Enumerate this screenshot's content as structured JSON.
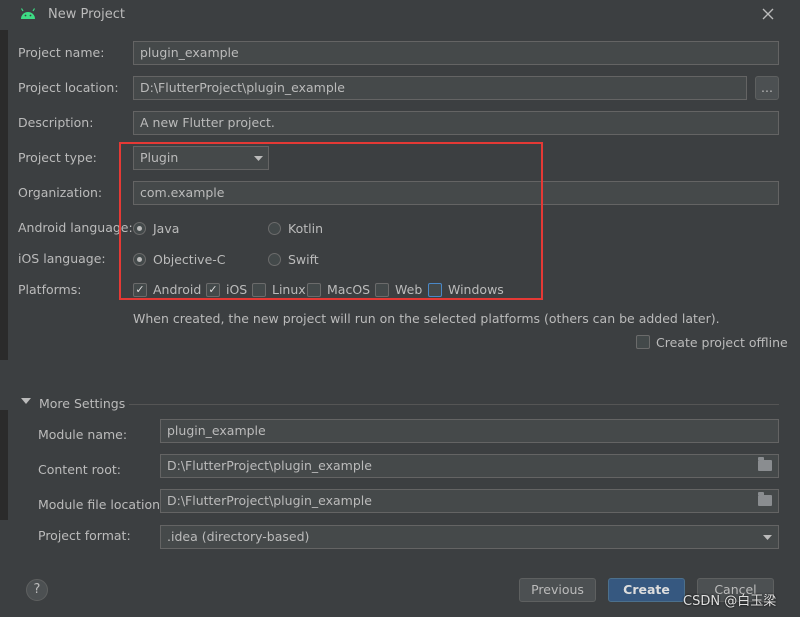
{
  "window": {
    "title": "New Project"
  },
  "form": {
    "project_name": {
      "label": "Project name:",
      "value": "plugin_example"
    },
    "project_location": {
      "label": "Project location:",
      "value": "D:\\FlutterProject\\plugin_example",
      "browse": "..."
    },
    "description": {
      "label": "Description:",
      "value": "A new Flutter project."
    },
    "project_type": {
      "label": "Project type:",
      "value": "Plugin"
    },
    "organization": {
      "label": "Organization:",
      "value": "com.example"
    },
    "android_language": {
      "label": "Android language:",
      "options": [
        "Java",
        "Kotlin"
      ],
      "selected": "Java"
    },
    "ios_language": {
      "label": "iOS language:",
      "options": [
        "Objective-C",
        "Swift"
      ],
      "selected": "Objective-C"
    },
    "platforms": {
      "label": "Platforms:",
      "items": [
        {
          "name": "Android",
          "checked": true
        },
        {
          "name": "iOS",
          "checked": true
        },
        {
          "name": "Linux",
          "checked": false
        },
        {
          "name": "MacOS",
          "checked": false
        },
        {
          "name": "Web",
          "checked": false
        },
        {
          "name": "Windows",
          "checked": false
        }
      ],
      "hint": "When created, the new project will run on the selected platforms (others can be added later)."
    },
    "offline": {
      "label": "Create project offline",
      "checked": false
    }
  },
  "more_settings": {
    "label": "More Settings",
    "module_name": {
      "label": "Module name:",
      "value": "plugin_example"
    },
    "content_root": {
      "label": "Content root:",
      "value": "D:\\FlutterProject\\plugin_example"
    },
    "module_file_location": {
      "label": "Module file location:",
      "value": "D:\\FlutterProject\\plugin_example"
    },
    "project_format": {
      "label": "Project format:",
      "value": ".idea (directory-based)"
    }
  },
  "footer": {
    "help": "?",
    "previous": "Previous",
    "create": "Create",
    "cancel": "Cancel"
  },
  "watermark": "CSDN @白玉梁",
  "colors": {
    "accent": "#365880",
    "highlight_box": "#e53935",
    "background": "#3c3f41"
  }
}
